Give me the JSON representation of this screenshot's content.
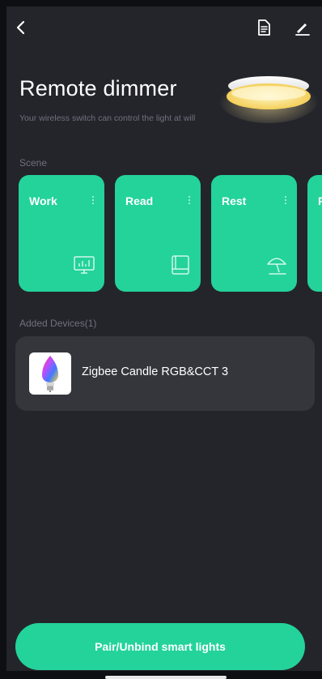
{
  "header": {
    "back_icon": "chevron-left-icon",
    "doc_icon": "document-icon",
    "edit_icon": "edit-pencil-icon"
  },
  "page": {
    "title": "Remote dimmer",
    "subtitle": "Your wireless switch can control the light at will"
  },
  "scenes": {
    "label": "Scene",
    "items": [
      {
        "name": "Work",
        "icon": "monitor-chart-icon"
      },
      {
        "name": "Read",
        "icon": "book-icon"
      },
      {
        "name": "Rest",
        "icon": "beach-umbrella-icon"
      },
      {
        "name": "R",
        "icon": ""
      }
    ]
  },
  "devices": {
    "label": "Added Devices(1)",
    "items": [
      {
        "name": "Zigbee Candle RGB&CCT 3",
        "icon": "rgb-candle-bulb-icon"
      }
    ]
  },
  "actions": {
    "pair_label": "Pair/Unbind smart lights"
  },
  "colors": {
    "accent": "#23d39a",
    "background": "#24252b",
    "card": "#34363c",
    "muted_text": "#6f727c"
  }
}
